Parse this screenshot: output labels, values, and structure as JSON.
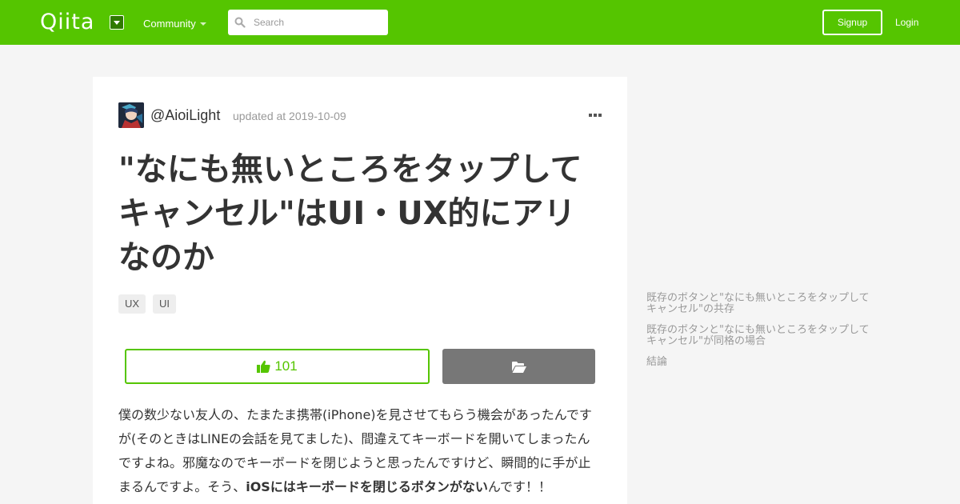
{
  "header": {
    "logo": "Qiita",
    "community_label": "Community",
    "search_placeholder": "Search",
    "signup_label": "Signup",
    "login_label": "Login",
    "brand_color": "#55c500"
  },
  "article": {
    "author": "@AioiLight",
    "updated": "updated at 2019-10-09",
    "title": "\"なにも無いところをタップしてキャンセル\"はUI・UX的にアリなのか",
    "tags": [
      "UX",
      "UI"
    ],
    "like_count": "101",
    "body_lines": [
      "僕の数少ない友人の、たまたま携帯(iPhone)を見させてもらう機会があったんです",
      "が(そのときはLINEの会話を見てました)、間違えてキーボードを開いてしまったん",
      "ですよね。邪魔なのでキーボードを閉じようと思ったんですけど、瞬間的に手が止"
    ],
    "body_last_prefix": "まるんですよ。そう、",
    "body_last_bold": "iOSにはキーボードを閉じるボタンがない",
    "body_last_suffix": "んです！！"
  },
  "toc": {
    "items": [
      "既存のボタンと\"なにも無いところをタップしてキャンセル\"の共存",
      "既存のボタンと\"なにも無いところをタップしてキャンセル\"が同格の場合",
      "結論"
    ]
  }
}
